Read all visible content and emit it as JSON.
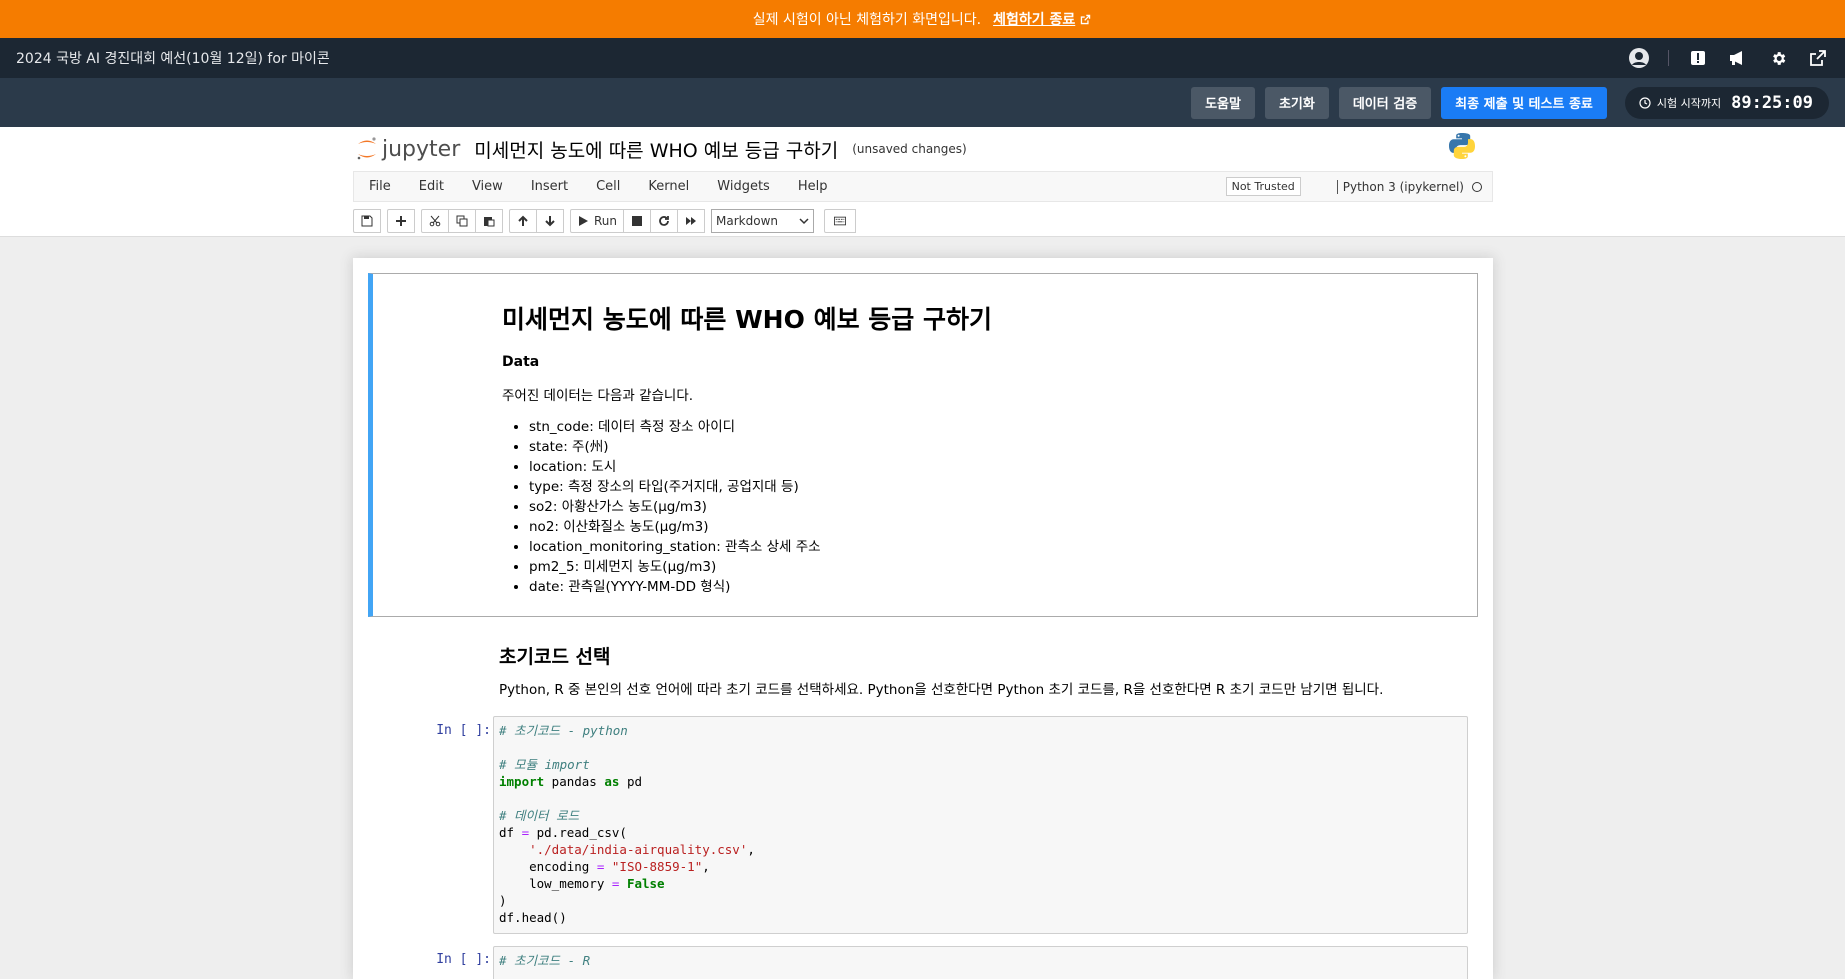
{
  "banner": {
    "message": "실제 시험이 아닌 체험하기 화면입니다.",
    "exit_label": "체험하기 종료"
  },
  "topbar": {
    "title": "2024 국방 AI 경진대회 예선(10월 12일) for 마이콘"
  },
  "actions": {
    "help": "도움말",
    "reset": "초기화",
    "validate": "데이터 검증",
    "submit": "최종 제출 및 테스트 종료",
    "timer_label": "시험 시작까지",
    "timer_value": "89:25:09"
  },
  "jupyter": {
    "logo_text": "jupyter",
    "notebook_name": "미세먼지 농도에 따른 WHO 예보 등급 구하기",
    "save_status": "(unsaved changes)",
    "menu": [
      "File",
      "Edit",
      "View",
      "Insert",
      "Cell",
      "Kernel",
      "Widgets",
      "Help"
    ],
    "trust": "Not Trusted",
    "kernel": "Python 3 (ipykernel)",
    "toolbar": {
      "run_label": "Run",
      "cell_type": "Markdown"
    }
  },
  "notebook": {
    "heading": "미세먼지 농도에 따른 WHO 예보 등급 구하기",
    "data_label": "Data",
    "intro": "주어진 데이터는 다음과 같습니다.",
    "fields": [
      "stn_code: 데이터 측정 장소 아이디",
      "state: 주(州)",
      "location: 도시",
      "type: 측정 장소의 타입(주거지대, 공업지대 등)",
      "so2: 아황산가스 농도(μg/m3)",
      "no2: 이산화질소 농도(μg/m3)",
      "location_monitoring_station: 관측소 상세 주소",
      "pm2_5: 미세먼지 농도(μg/m3)",
      "date: 관측일(YYYY-MM-DD 형식)"
    ],
    "section_heading": "초기코드 선택",
    "section_text": "Python, R 중 본인의 선호 언어에 따라 초기 코드를 선택하세요. Python을 선호한다면 Python 초기 코드를, R을 선호한다면 R 초기 코드만 남기면 됩니다.",
    "prompt1": "In [ ]:",
    "prompt2": "In [ ]:",
    "code1": {
      "c1": "# 초기코드 - python",
      "c2": "# 모듈 import",
      "kw_import": "import",
      "import_rest": " pandas ",
      "kw_as": "as",
      "alias": " pd",
      "c3": "# 데이터 로드",
      "read_open": "df ",
      "eq": "=",
      "read_call": " pd.read_csv(",
      "path": "'./data/india-airquality.csv'",
      "enc_key": "    encoding ",
      "enc_val": "\"ISO-8859-1\"",
      "mem_key": "    low_memory ",
      "mem_val": "False",
      "close": ")",
      "head": "df.head()"
    },
    "code2": {
      "c1": "# 초기코드 - R"
    }
  }
}
